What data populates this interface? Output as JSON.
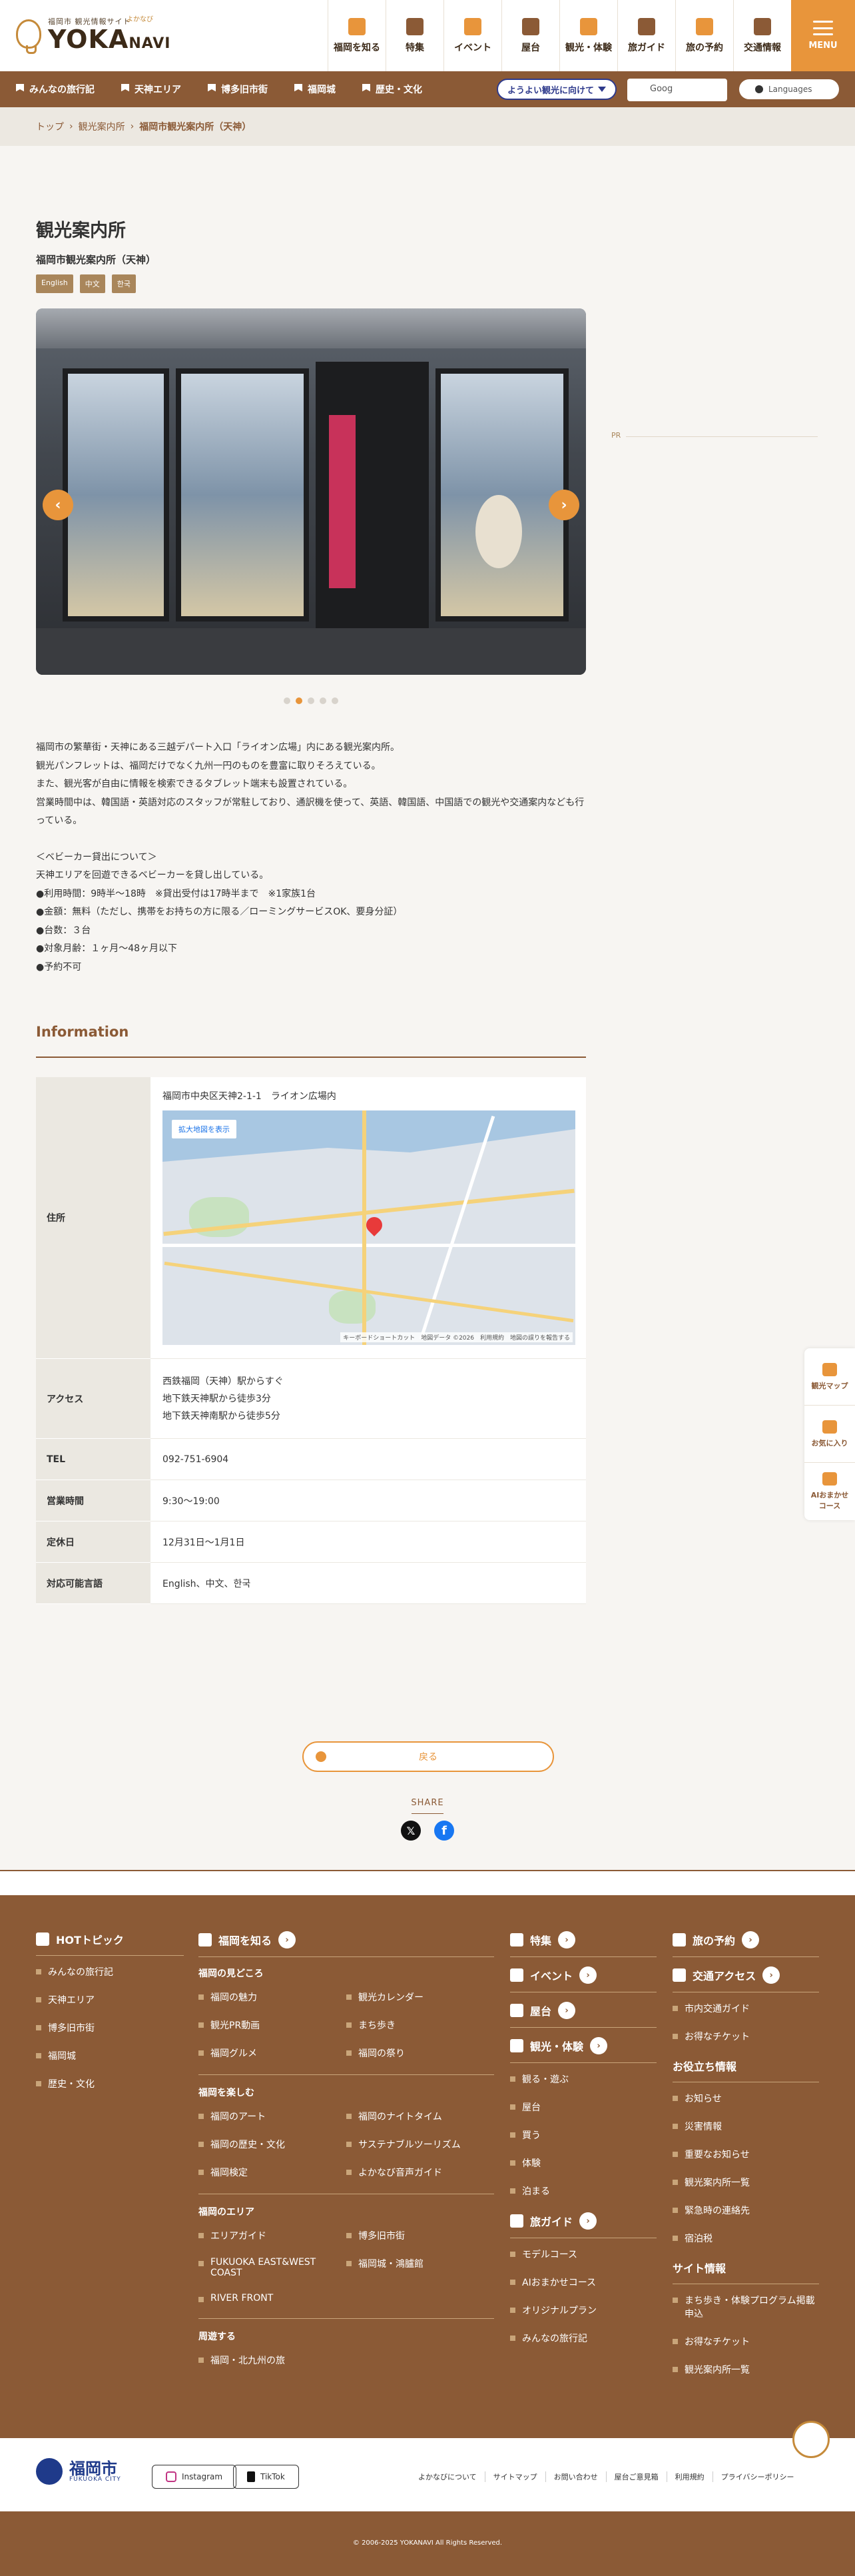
{
  "header": {
    "logo_small": "福岡市 観光情報サイト",
    "logo_main": "YOKA",
    "logo_main2": "NAVI",
    "logo_ruby": "よかなび",
    "nav": [
      "福岡を知る",
      "特集",
      "イベント",
      "屋台",
      "観光・体験",
      "旅ガイド",
      "旅の予約",
      "交通情報"
    ],
    "menu_label": "MENU"
  },
  "subbar": {
    "items": [
      "みんなの旅行記",
      "天神エリア",
      "博多旧市街",
      "福岡城",
      "歴史・文化"
    ],
    "welcome": "ようよい観光に向けて",
    "google_placeholder": "Goog",
    "languages": "Languages"
  },
  "breadcrumb": [
    "トップ",
    "観光案内所",
    "福岡市観光案内所（天神）"
  ],
  "page": {
    "title": "観光案内所",
    "subtitle": "福岡市観光案内所（天神）",
    "badges": [
      "English",
      "中文",
      "한국"
    ],
    "pr": "PR"
  },
  "description": [
    "福岡市の繁華街・天神にある三越デパート入口「ライオン広場」内にある観光案内所。",
    "観光パンフレットは、福岡だけでなく九州一円のものを豊富に取りそろえている。",
    "また、観光客が自由に情報を検索できるタブレット端末も設置されている。",
    "営業時間中は、韓国語・英語対応のスタッフが常駐しており、通訳機を使って、英語、韓国語、中国語での観光や交通案内なども行っている。",
    "",
    "＜ベビーカー貸出について＞",
    "天神エリアを回遊できるベビーカーを貸し出している。",
    "●利用時間：9時半〜18時　※貸出受付は17時半まで　※1家族1台",
    "●金額：無料（ただし、携帯をお持ちの方に限る／ローミングサービスOK、要身分証）",
    "●台数：３台",
    "●対象月齢：１ヶ月〜48ヶ月以下",
    "●予約不可"
  ],
  "info": {
    "heading": "Information",
    "address_label": "住所",
    "address": "福岡市中央区天神2-1-1　ライオン広場内",
    "map_button": "拡大地図を表示",
    "map_credit": "キーボードショートカット　地図データ ©2026　利用規約　地図の誤りを報告する",
    "access_label": "アクセス",
    "access": [
      "西鉄福岡（天神）駅からすぐ",
      "地下鉄天神駅から徒歩3分",
      "地下鉄天神南駅から徒歩5分"
    ],
    "tel_label": "TEL",
    "tel": "092-751-6904",
    "hours_label": "営業時間",
    "hours": "9:30〜19:00",
    "closed_label": "定休日",
    "closed": "12月31日〜1月1日",
    "lang_label": "対応可能言語",
    "languages": "English、中文、한국"
  },
  "back_label": "戻る",
  "share_label": "SHARE",
  "side_tools": [
    "観光マップ",
    "お気に入り",
    "AIおまかせコース"
  ],
  "pr_band": "PR",
  "footer": {
    "hot_topic": "HOTトピック",
    "hot_items": [
      "みんなの旅行記",
      "天神エリア",
      "博多旧市街",
      "福岡城",
      "歴史・文化"
    ],
    "know": "福岡を知る",
    "miru": "福岡の見どころ",
    "miru_items": [
      "福岡の魅力",
      "観光カレンダー",
      "観光PR動画",
      "まち歩き",
      "福岡グルメ",
      "福岡の祭り"
    ],
    "enjoy": "福岡を楽しむ",
    "enjoy_items": [
      "福岡のアート",
      "福岡のナイトタイム",
      "福岡の歴史・文化",
      "サステナブルツーリズム",
      "福岡検定",
      "よかなび音声ガイド"
    ],
    "area": "福岡のエリア",
    "area_items": [
      "エリアガイド",
      "博多旧市街",
      "FUKUOKA EAST&WEST COAST",
      "福岡城・鴻臚館",
      "RIVER FRONT"
    ],
    "around": "周遊する",
    "around_items": [
      "福岡・北九州の旅"
    ],
    "tokushu": "特集",
    "event": "イベント",
    "yatai": "屋台",
    "kanko": "観光・体験",
    "kanko_items": [
      "観る・遊ぶ",
      "屋台",
      "買う",
      "体験",
      "泊まる"
    ],
    "guide": "旅ガイド",
    "guide_items": [
      "モデルコース",
      "AIおまかせコース",
      "オリジナルプラン",
      "みんなの旅行記"
    ],
    "yoyaku": "旅の予約",
    "kotsu": "交通アクセス",
    "kotsu_items": [
      "市内交通ガイド",
      "お得なチケット"
    ],
    "useful": "お役立ち情報",
    "useful_items": [
      "お知らせ",
      "災害情報",
      "重要なお知らせ",
      "観光案内所一覧",
      "緊急時の連絡先",
      "宿泊税"
    ],
    "site": "サイト情報",
    "site_items": [
      "まち歩き・体験プログラム掲載申込",
      "お得なチケット",
      "観光案内所一覧"
    ]
  },
  "footer_bottom": {
    "city": "福岡市",
    "city_en": "FUKUOKA CITY",
    "instagram": "Instagram",
    "tiktok": "TikTok",
    "links": [
      "よかなびについて",
      "サイトマップ",
      "お問い合わせ",
      "屋台ご意見箱",
      "利用規約",
      "プライバシーポリシー"
    ],
    "copyright": "© 2006-2025 YOKANAVI All Rights Reserved."
  }
}
